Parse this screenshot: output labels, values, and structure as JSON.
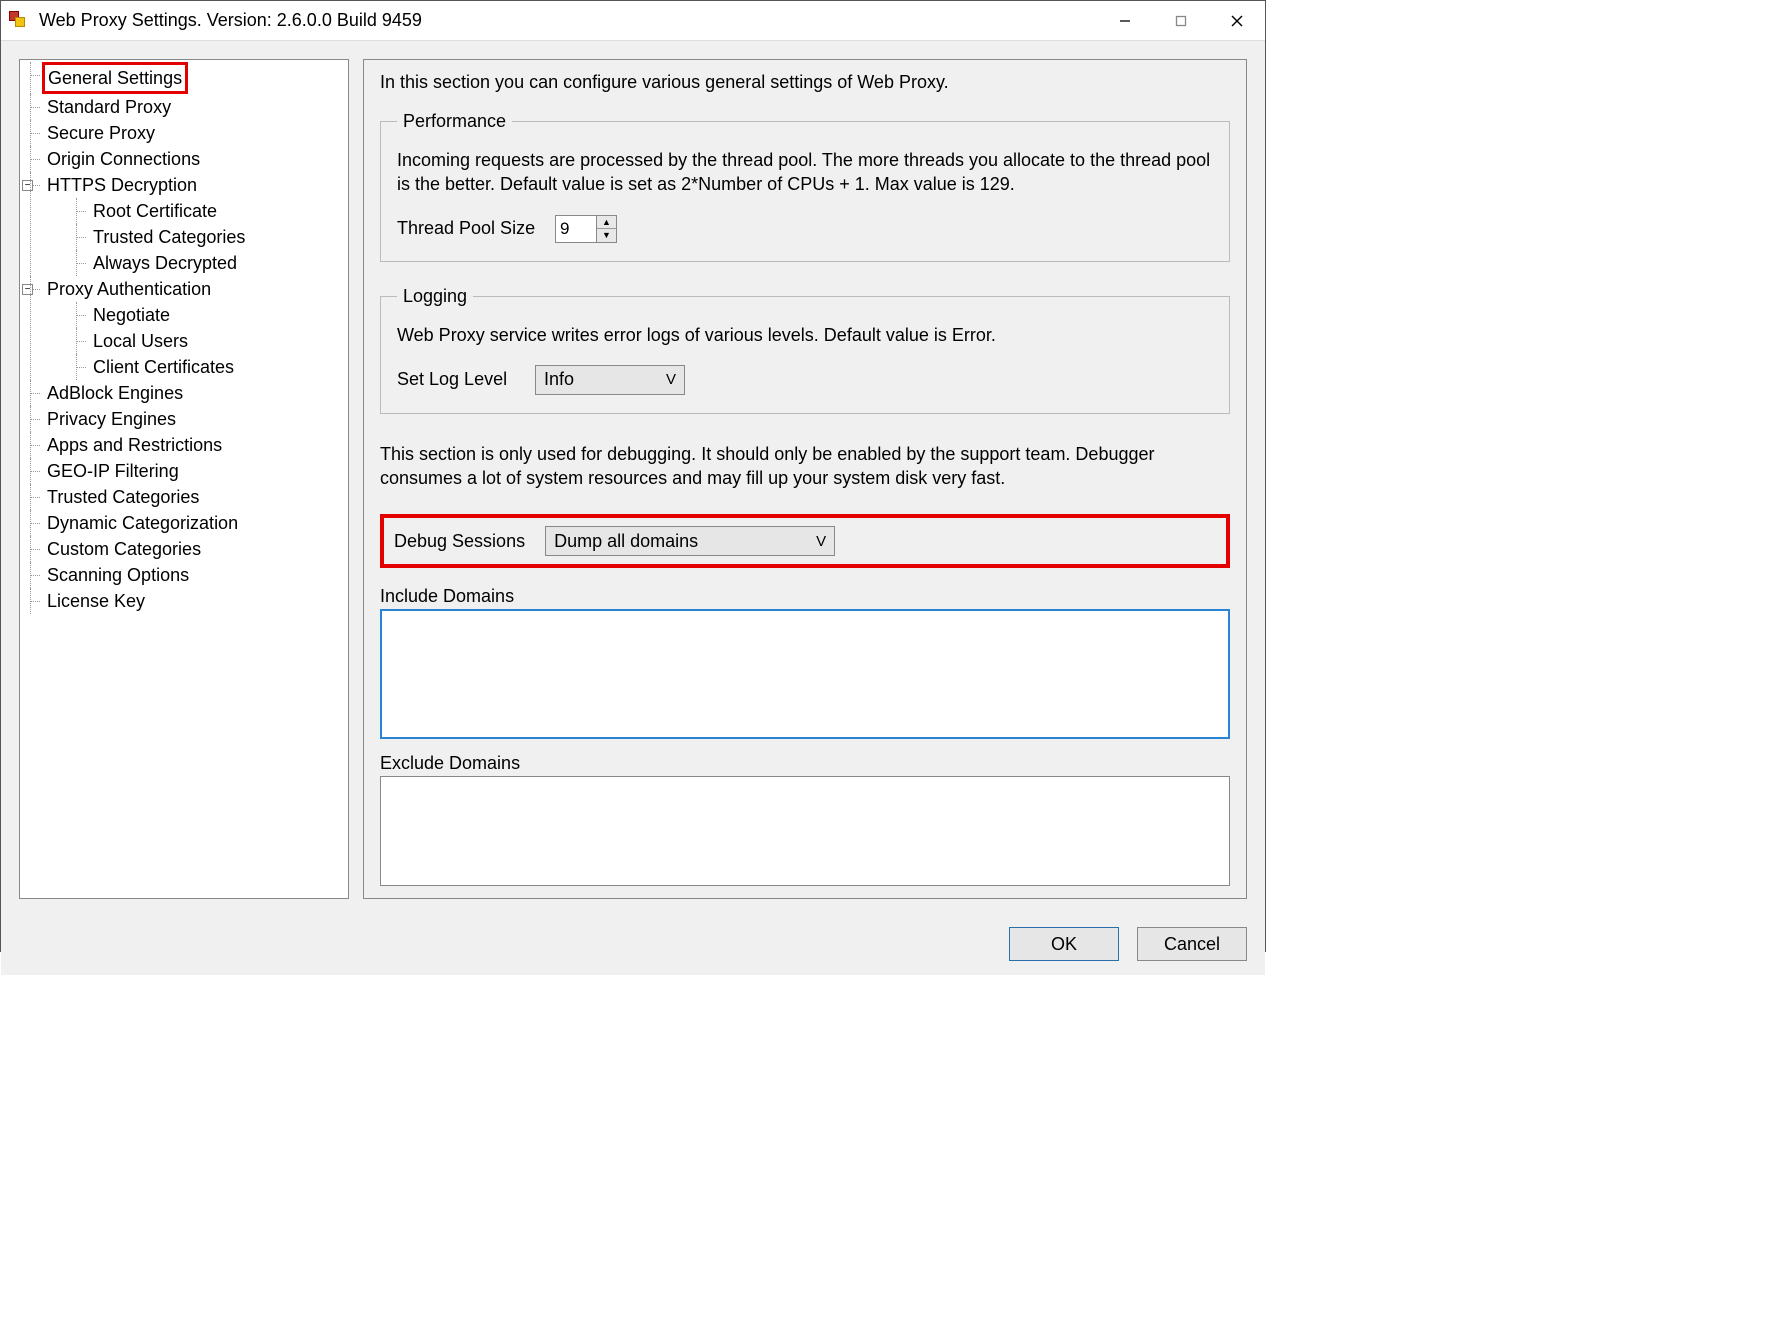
{
  "window": {
    "title": "Web Proxy Settings. Version: 2.6.0.0 Build 9459"
  },
  "tree": {
    "general": "General Settings",
    "standard": "Standard Proxy",
    "secure": "Secure Proxy",
    "origin_connections": "Origin Connections",
    "https_decryption": "HTTPS Decryption",
    "root_cert": "Root Certificate",
    "trusted_cats_https": "Trusted Categories",
    "always_decrypted": "Always Decrypted",
    "proxy_auth": "Proxy Authentication",
    "negotiate": "Negotiate",
    "local_users": "Local Users",
    "client_certs": "Client Certificates",
    "adblock": "AdBlock Engines",
    "privacy": "Privacy Engines",
    "apps_restrictions": "Apps and Restrictions",
    "geoip": "GEO-IP Filtering",
    "trusted_cats": "Trusted Categories",
    "dyn_cat": "Dynamic Categorization",
    "custom_cats": "Custom Categories",
    "scanning": "Scanning Options",
    "license": "License Key"
  },
  "main": {
    "intro": "In this section you can configure various general settings of Web Proxy.",
    "perf": {
      "legend": "Performance",
      "desc": "Incoming requests are processed by the thread pool. The more threads you allocate to the thread pool is the better. Default value is set as 2*Number of CPUs + 1. Max value is 129.",
      "pool_label": "Thread Pool Size",
      "pool_value": "9"
    },
    "logging": {
      "legend": "Logging",
      "desc": "Web Proxy service writes error logs of various levels. Default value is Error.",
      "level_label": "Set Log Level",
      "level_value": "Info"
    },
    "debug": {
      "desc": "This section is only used for debugging. It should only be enabled by the support team. Debugger consumes a lot of system resources and may fill up your system disk very fast.",
      "sessions_label": "Debug Sessions",
      "sessions_value": "Dump all domains",
      "include_label": "Include Domains",
      "include_value": "",
      "exclude_label": "Exclude Domains",
      "exclude_value": ""
    }
  },
  "buttons": {
    "ok": "OK",
    "cancel": "Cancel"
  }
}
